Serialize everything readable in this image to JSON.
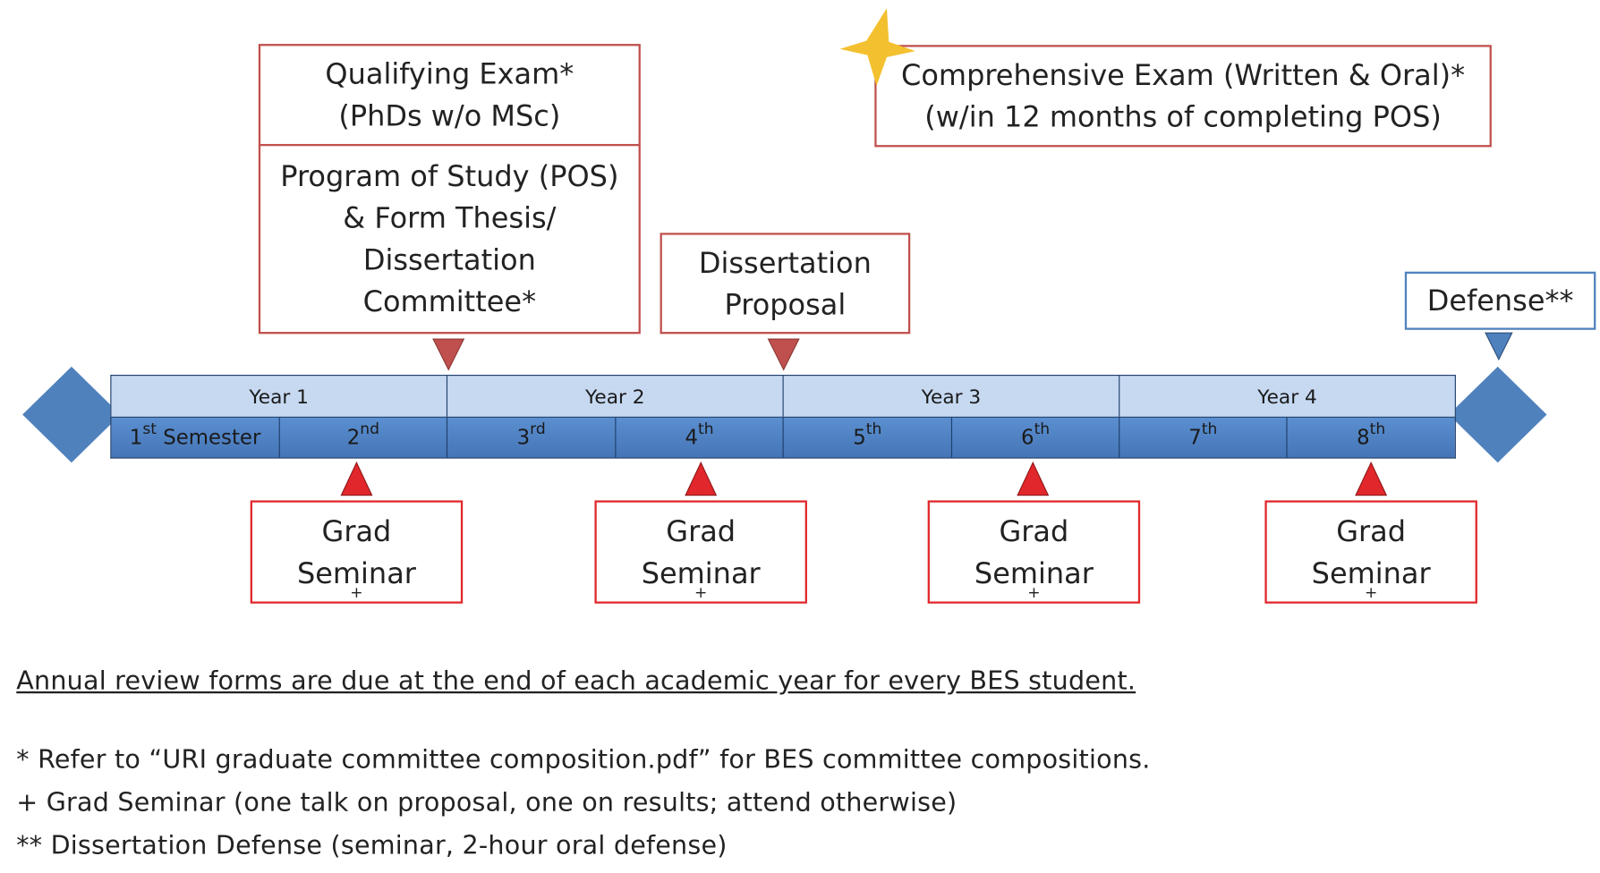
{
  "top_boxes": {
    "qualifying": [
      "Qualifying Exam*",
      "(PhDs w/o MSc)"
    ],
    "pos": [
      "Program of Study (POS)",
      "& Form Thesis/",
      "Dissertation",
      "Committee*"
    ],
    "proposal": [
      "Dissertation",
      "Proposal"
    ],
    "comprehensive": [
      "Comprehensive Exam (Written & Oral)*",
      "(w/in 12 months of completing POS)"
    ],
    "defense": "Defense**"
  },
  "years": [
    "Year 1",
    "Year 2",
    "Year 3",
    "Year 4"
  ],
  "semesters": [
    {
      "num": "1",
      "sup": "st",
      "suffix": " Semester"
    },
    {
      "num": "2",
      "sup": "nd",
      "suffix": ""
    },
    {
      "num": "3",
      "sup": "rd",
      "suffix": ""
    },
    {
      "num": "4",
      "sup": "th",
      "suffix": ""
    },
    {
      "num": "5",
      "sup": "th",
      "suffix": ""
    },
    {
      "num": "6",
      "sup": "th",
      "suffix": ""
    },
    {
      "num": "7",
      "sup": "th",
      "suffix": ""
    },
    {
      "num": "8",
      "sup": "th",
      "suffix": ""
    }
  ],
  "seminar": {
    "line1": "Grad",
    "line2": "Seminar",
    "mark": "+"
  },
  "notes": {
    "annual": "Annual review forms are due at the end of each academic year for every BES student.",
    "star_note": "* Refer to “URI graduate committee composition.pdf” for BES committee compositions.",
    "plus_note": "+ Grad Seminar (one talk on proposal, one on results; attend otherwise)",
    "dstar_note": "** Dissertation Defense (seminar, 2-hour oral defense)"
  },
  "colors": {
    "box_border": "#c0504d",
    "seminar_border": "#e1272b",
    "defense_border": "#4f81bd",
    "year_row": "#c6d9f1",
    "semester_row": "#4f81bd",
    "diamond": "#4f81bd",
    "milestone_marker": "#c0504d",
    "seminar_marker": "#e1272b",
    "star": "#f3c12f"
  }
}
